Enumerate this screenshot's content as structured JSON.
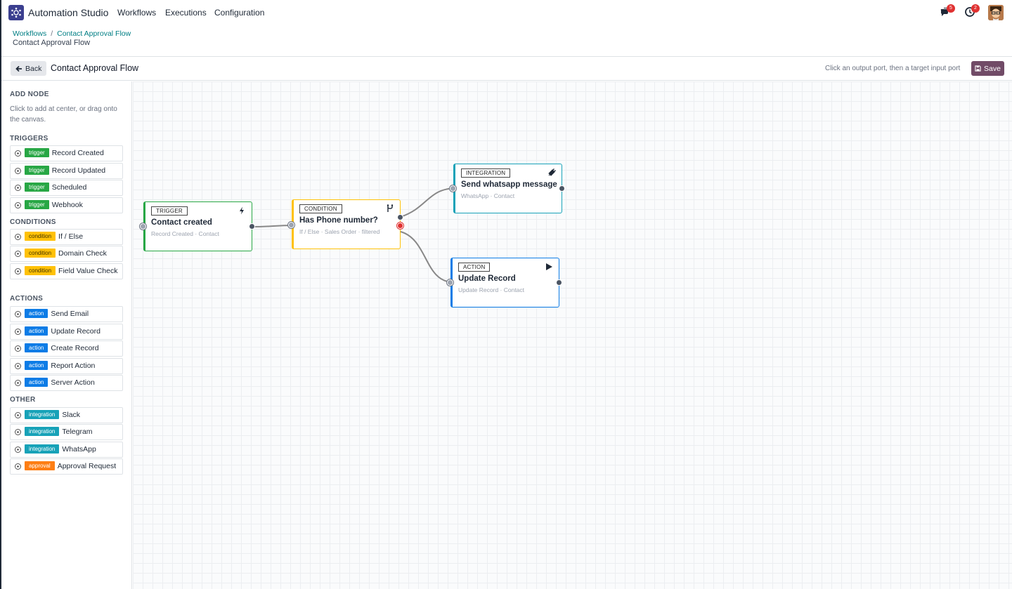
{
  "app": {
    "name": "Automation Studio"
  },
  "nav": {
    "items": [
      "Workflows",
      "Executions",
      "Configuration"
    ]
  },
  "systray": {
    "messages_count": "5",
    "activity_count": "2"
  },
  "breadcrumb": {
    "parent": "Workflows",
    "separator": "/",
    "link": "Contact Approval Flow",
    "current": "Contact Approval Flow"
  },
  "toolbar": {
    "back_label": "Back",
    "title": "Contact Approval Flow",
    "hint": "Click an output port, then a target input port",
    "save_label": "Save"
  },
  "sidebar": {
    "heading": "ADD NODE",
    "help": "Click to add at center, or drag onto the canvas.",
    "groups": [
      {
        "title": "TRIGGERS",
        "items": [
          {
            "tag": "trigger",
            "label": "Record Created"
          },
          {
            "tag": "trigger",
            "label": "Record Updated"
          },
          {
            "tag": "trigger",
            "label": "Scheduled"
          },
          {
            "tag": "trigger",
            "label": "Webhook"
          }
        ]
      },
      {
        "title": "CONDITIONS",
        "items": [
          {
            "tag": "condition",
            "label": "If / Else"
          },
          {
            "tag": "condition",
            "label": "Domain Check"
          },
          {
            "tag": "condition",
            "label": "Field Value Check"
          }
        ]
      },
      {
        "title": "ACTIONS",
        "items": [
          {
            "tag": "action",
            "label": "Send Email"
          },
          {
            "tag": "action",
            "label": "Update Record"
          },
          {
            "tag": "action",
            "label": "Create Record"
          },
          {
            "tag": "action",
            "label": "Report Action"
          },
          {
            "tag": "action",
            "label": "Server Action"
          }
        ]
      },
      {
        "title": "OTHER",
        "items": [
          {
            "tag": "integration",
            "label": "Slack"
          },
          {
            "tag": "integration",
            "label": "Telegram"
          },
          {
            "tag": "integration",
            "label": "WhatsApp"
          },
          {
            "tag": "approval",
            "label": "Approval Request"
          }
        ]
      }
    ]
  },
  "nodes": {
    "trigger": {
      "type": "TRIGGER",
      "title": "Contact created",
      "subtitle": "Record Created · Contact",
      "icon": "bolt-icon"
    },
    "condition": {
      "type": "CONDITION",
      "title": "Has Phone number?",
      "subtitle": "If / Else · Sales Order · filtered",
      "icon": "branch-icon"
    },
    "integration": {
      "type": "INTEGRATION",
      "title": "Send whatsapp message",
      "subtitle": "WhatsApp · Contact",
      "icon": "plug-icon"
    },
    "action": {
      "type": "ACTION",
      "title": "Update Record",
      "subtitle": "Update Record · Contact",
      "icon": "play-icon"
    }
  },
  "colors": {
    "trigger": "#28a745",
    "condition": "#ffc107",
    "action": "#0d7ce6",
    "integration": "#17a2b8",
    "approval": "#fd7e14",
    "brand": "#714b67",
    "link": "#017e84",
    "false_port": "#e03131"
  }
}
